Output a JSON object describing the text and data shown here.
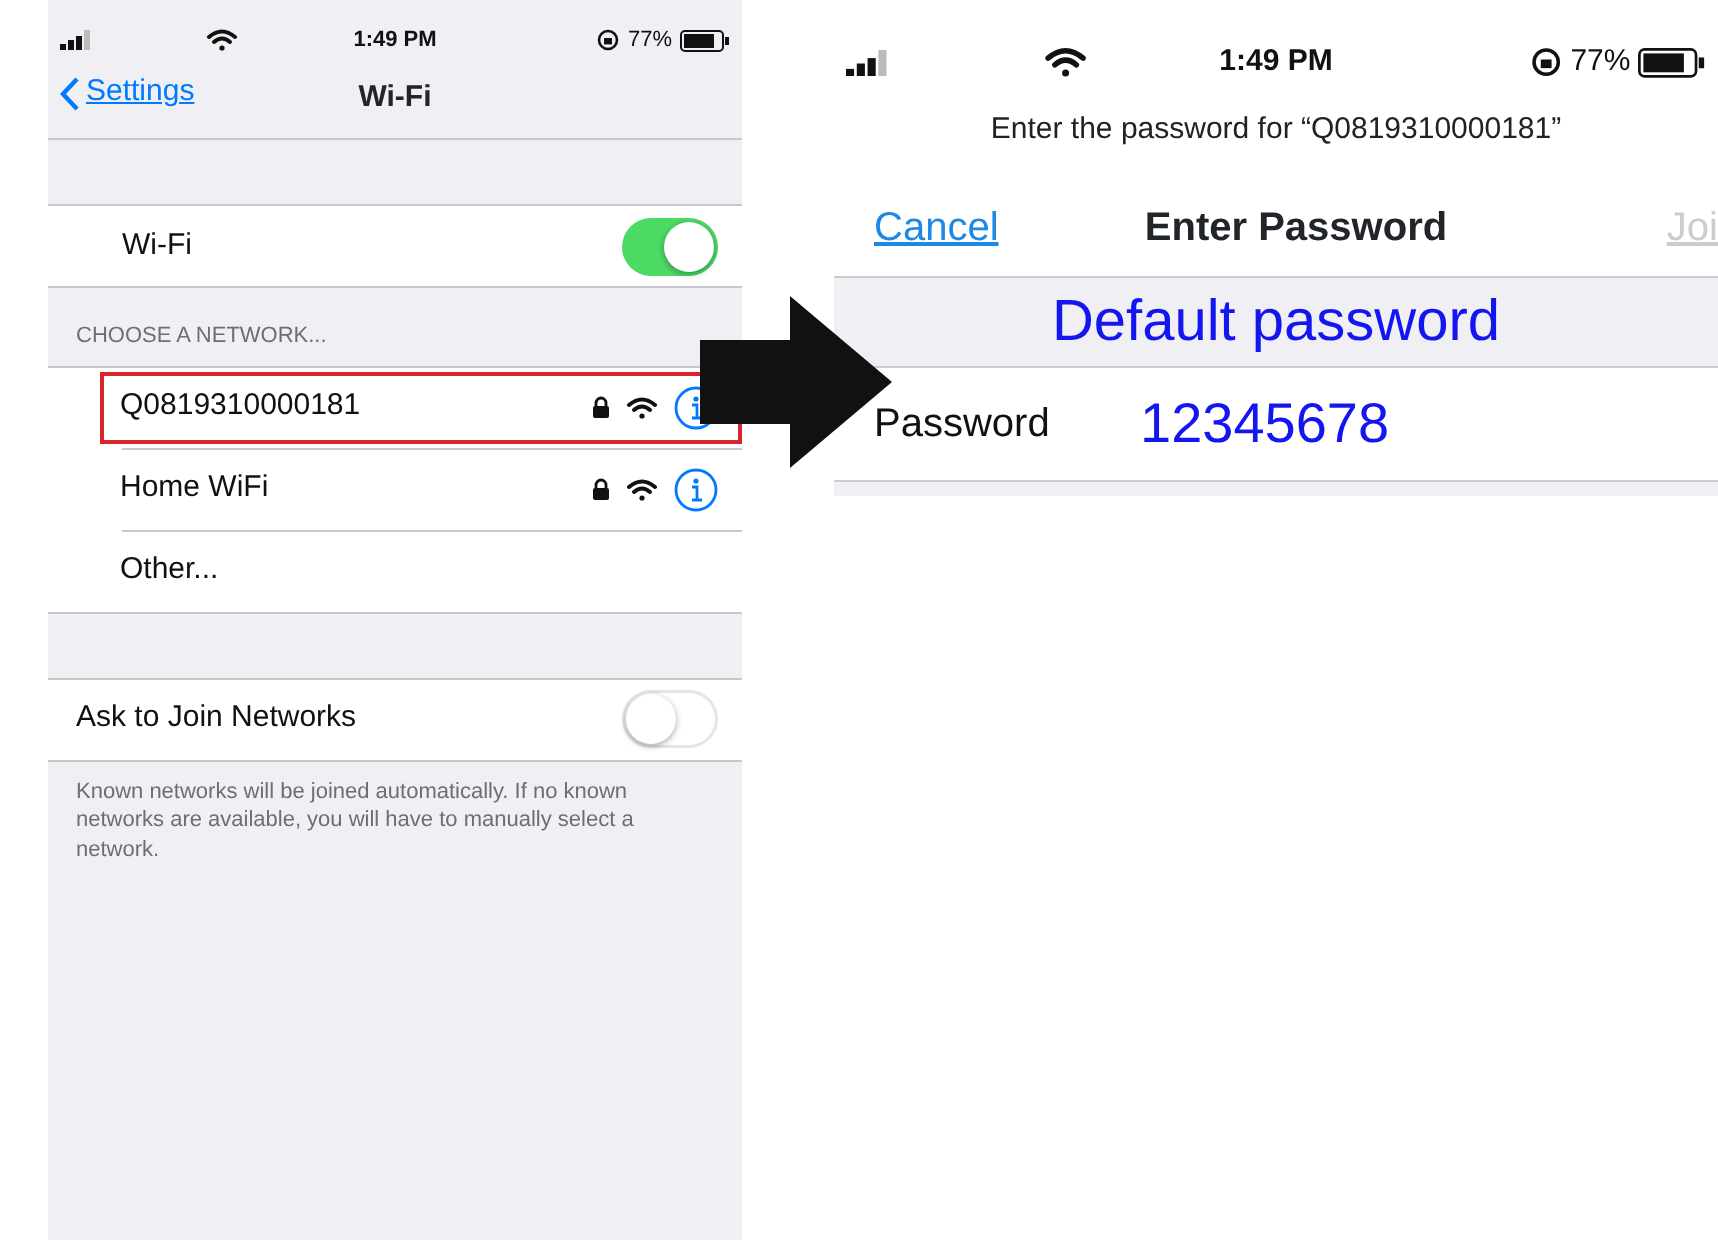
{
  "left_screen": {
    "status_bar": {
      "time": "1:49 PM",
      "battery": "77%"
    },
    "nav": {
      "back": "Settings",
      "title": "Wi-Fi"
    },
    "wifi_row": {
      "label": "Wi-Fi",
      "on": true
    },
    "section_header": "CHOOSE A NETWORK...",
    "networks": [
      {
        "kind": "network",
        "name": "Q0819310000181",
        "highlighted": true
      },
      {
        "kind": "network",
        "name": "Home WiFi",
        "highlighted": false
      },
      {
        "kind": "other",
        "name": "Other...",
        "highlighted": false
      }
    ],
    "ask_row": {
      "label": "Ask to Join Networks",
      "on": false
    },
    "footer": "Known networks will be joined automatically. If no known networks are available, you will have to manually select a network."
  },
  "right_screen": {
    "status_bar": {
      "time": "1:49 PM",
      "battery": "77%"
    },
    "prompt": "Enter the password for “Q0819310000181”",
    "nav": {
      "cancel": "Cancel",
      "title": "Enter Password",
      "join": "Joi",
      "join_disabled": true
    },
    "annotation": "Default password",
    "field": {
      "label": "Password",
      "value": "12345678"
    }
  }
}
